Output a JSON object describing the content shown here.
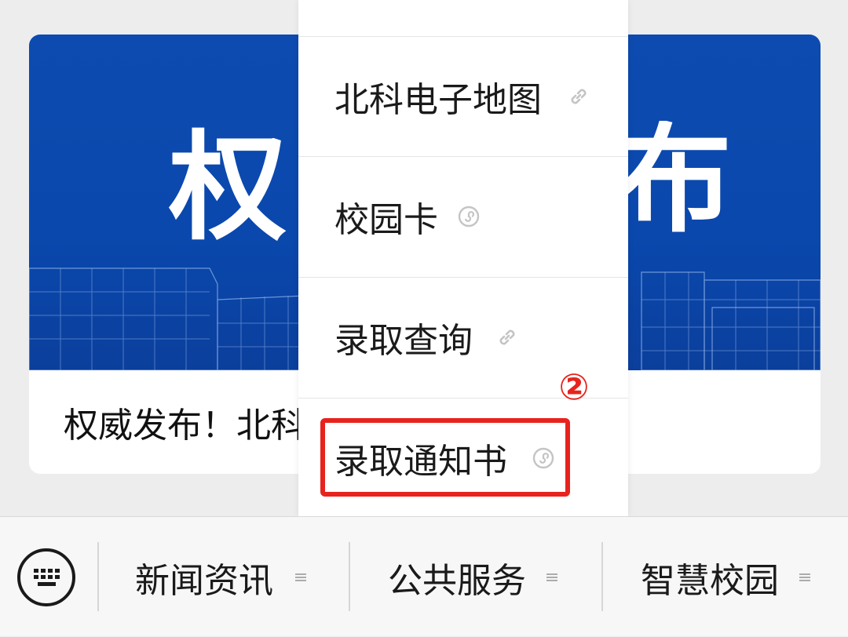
{
  "article": {
    "banner_chars": [
      "权",
      "布"
    ],
    "title": "权威发布！北科"
  },
  "menu": {
    "items": [
      {
        "label": "北科电子地图",
        "icon": "link-icon"
      },
      {
        "label": "校园卡",
        "icon": "mini-program-icon"
      },
      {
        "label": "录取查询",
        "icon": "link-icon"
      },
      {
        "label": "录取通知书",
        "icon": "mini-program-icon"
      }
    ],
    "step_marker": "②",
    "highlight_color": "#e8231d"
  },
  "bottom_nav": {
    "keyboard_icon": "keyboard-icon",
    "items": [
      {
        "label": "新闻资讯",
        "icon": "menu-lines-icon"
      },
      {
        "label": "公共服务",
        "icon": "menu-lines-icon"
      },
      {
        "label": "智慧校园",
        "icon": "menu-lines-icon"
      }
    ]
  }
}
